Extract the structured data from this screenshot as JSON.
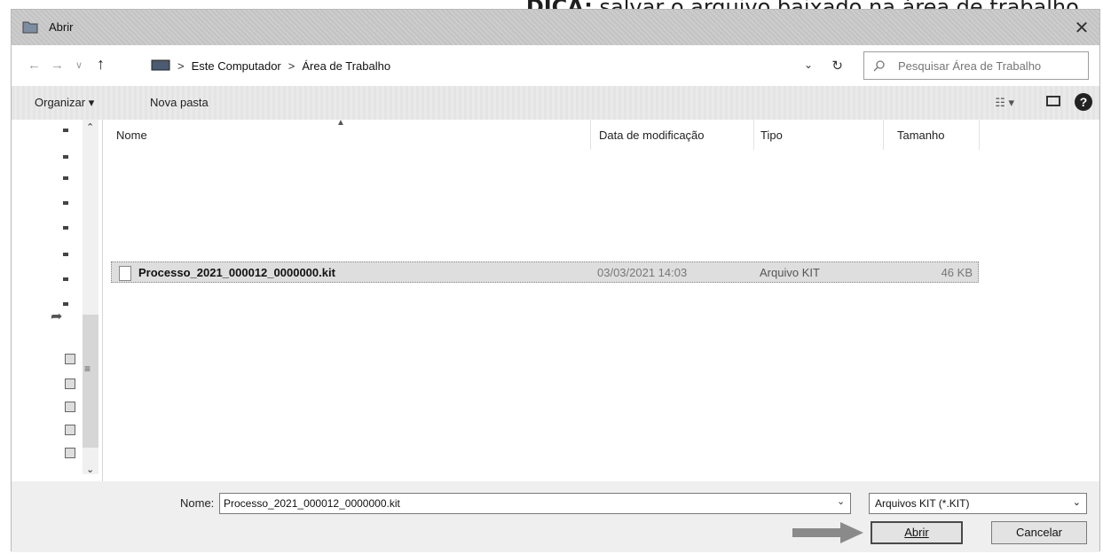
{
  "tip": {
    "prefix": "DICA:",
    "text": " salvar o arquivo baixado na área de trabalho."
  },
  "window": {
    "title": "Abrir",
    "close_symbol": "✕"
  },
  "address": {
    "back_symbol": "←",
    "forward_symbol": "→",
    "recent_symbol": "∨",
    "up_symbol": "↑",
    "breadcrumb": [
      "Este Computador",
      "Área de Trabalho"
    ],
    "separator": ">",
    "chevron_symbol": "⌄",
    "refresh_symbol": "↻",
    "search_placeholder": "Pesquisar Área de Trabalho"
  },
  "toolbar": {
    "organize_label": "Organizar ▾",
    "new_folder_label": "Nova pasta",
    "view_label": "☷ ▾",
    "help_symbol": "?"
  },
  "columns": {
    "name": "Nome",
    "date": "Data de modificação",
    "type": "Tipo",
    "size": "Tamanho"
  },
  "files": [
    {
      "name": "Processo_2021_000012_0000000.kit",
      "date": "03/03/2021 14:03",
      "type": "Arquivo KIT",
      "size": "46 KB"
    }
  ],
  "bottom": {
    "name_label": "Nome:",
    "name_value": "Processo_2021_000012_0000000.kit",
    "filter_value": "Arquivos KIT (*.KIT)",
    "open_label": "Abrir",
    "cancel_label": "Cancelar"
  },
  "icons": {
    "window_icon": "folder-icon",
    "pc_icon": "computer-icon",
    "search_icon": "search-icon",
    "file_icon": "document-icon"
  },
  "colors": {
    "titlebar": "#c9c9c9",
    "selection": "#dedede",
    "help": "#222222"
  }
}
